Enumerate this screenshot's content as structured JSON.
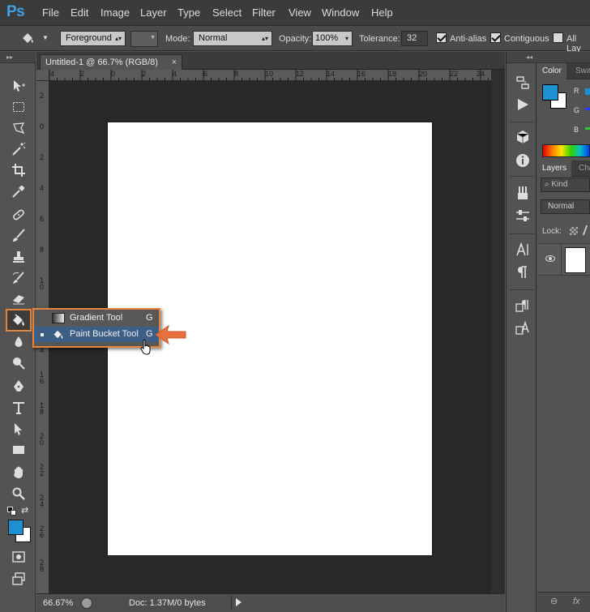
{
  "app": {
    "logo": "Ps"
  },
  "menu": [
    "File",
    "Edit",
    "Image",
    "Layer",
    "Type",
    "Select",
    "Filter",
    "View",
    "Window",
    "Help"
  ],
  "options": {
    "fill_source": "Foreground",
    "mode_label": "Mode:",
    "mode_value": "Normal",
    "opacity_label": "Opacity:",
    "opacity_value": "100%",
    "tolerance_label": "Tolerance:",
    "tolerance_value": "32",
    "antialias_label": "Anti-alias",
    "contiguous_label": "Contiguous",
    "all_layers_label": "All Lay"
  },
  "document": {
    "tab_title": "Untitled-1 @ 66.7% (RGB/8)",
    "close_glyph": "×"
  },
  "rulers": {
    "top": [
      "4",
      "2",
      "0",
      "2",
      "4",
      "6",
      "8",
      "10",
      "12",
      "14",
      "16",
      "18",
      "20",
      "22",
      "24"
    ],
    "left": [
      "2",
      "0",
      "2",
      "4",
      "6",
      "8",
      "1 0",
      "1 2",
      "1 4",
      "1 6",
      "1 8",
      "2 0",
      "2 2",
      "2 4",
      "2 6",
      "2 8"
    ]
  },
  "flyout": {
    "items": [
      {
        "label": "Gradient Tool",
        "shortcut": "G",
        "selected": false
      },
      {
        "label": "Paint Bucket Tool",
        "shortcut": "G",
        "selected": true
      }
    ]
  },
  "status": {
    "zoom": "66.67%",
    "doc_info": "Doc: 1.37M/0 bytes"
  },
  "panels": {
    "color_tab": "Color",
    "swatches_tab": "Swa",
    "rgb_labels": [
      "R",
      "G",
      "B"
    ],
    "layers_tab": "Layers",
    "channels_tab": "Cha",
    "kind_placeholder": "Kind",
    "blend_mode": "Normal",
    "lock_label": "Lock:",
    "fx_label": "fx"
  },
  "colors": {
    "foreground": "#1e8fd0",
    "background": "#ffffff",
    "highlight_border": "#e8833a",
    "selected_item": "#3d5f86"
  }
}
